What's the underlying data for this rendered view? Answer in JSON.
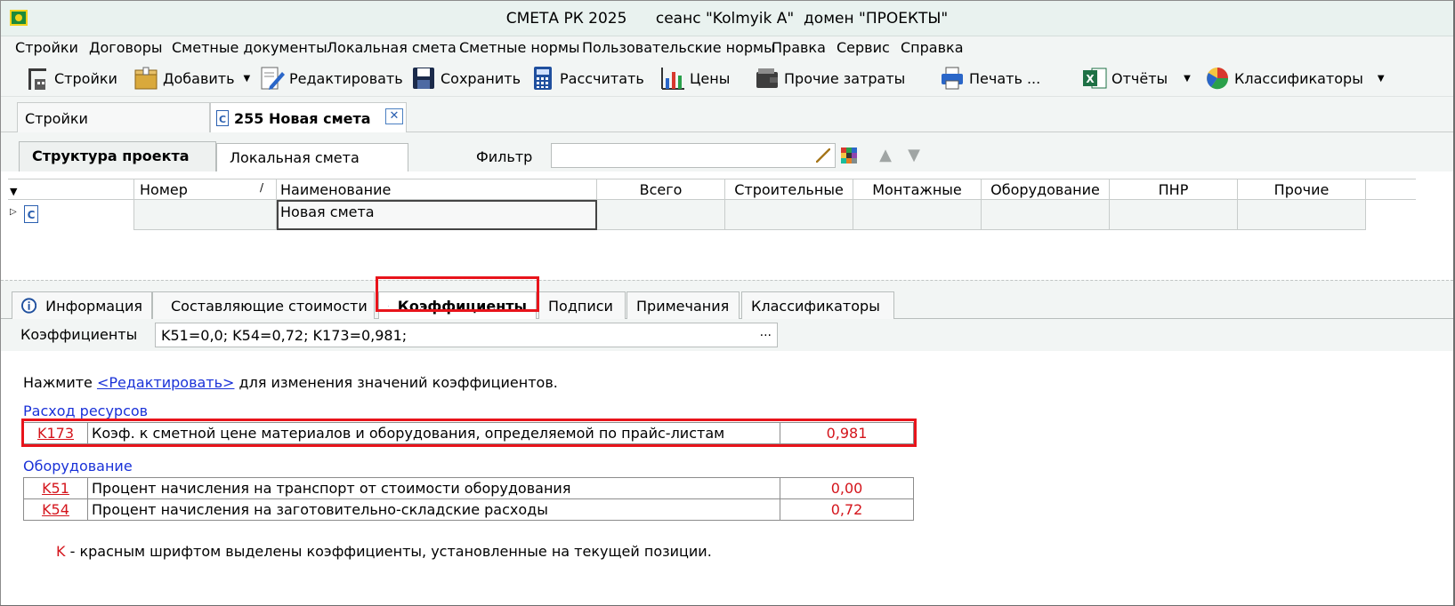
{
  "window": {
    "title": "СМЕТА РК 2025      сеанс \"Kolmyik A\"  домен \"ПРОЕКТЫ\""
  },
  "menu": [
    "Стройки",
    "Договоры",
    "Сметные документы",
    "Локальная смета",
    "Сметные нормы",
    "Пользовательские нормы",
    "Правка",
    "Сервис",
    "Справка"
  ],
  "toolbar": {
    "stroyki": "Стройки",
    "add": "Добавить",
    "edit": "Редактировать",
    "save": "Сохранить",
    "calc": "Рассчитать",
    "prices": "Цены",
    "other_costs": "Прочие затраты",
    "print": "Печать ...",
    "reports": "Отчёты",
    "classifiers": "Классификаторы"
  },
  "doc_tabs": {
    "stroyki": "Стройки",
    "smeta": "255 Новая смета",
    "close": "✕"
  },
  "project_tabs": {
    "structure": "Структура проекта",
    "local": "Локальная смета"
  },
  "filter": {
    "label": "Фильтр",
    "value": ""
  },
  "grid": {
    "columns": [
      "Номер",
      "Наименование",
      "Всего",
      "Строительные",
      "Монтажные",
      "Оборудование",
      "ПНР",
      "Прочие"
    ],
    "rows": [
      {
        "number": "",
        "name": "Новая смета",
        "total": "",
        "building": "",
        "mounting": "",
        "equipment": "",
        "pnr": "",
        "other": ""
      }
    ]
  },
  "info_tabs": {
    "info": "Информация",
    "components": "Составляющие стоимости",
    "coefficients": "Коэффициенты",
    "signatures": "Подписи",
    "notes": "Примечания",
    "classifiers": "Классификаторы"
  },
  "coefficients": {
    "label": "Коэффициенты",
    "value": "K51=0,0; K54=0,72; K173=0,981;",
    "dots": "...",
    "hint_prefix": "Нажмите ",
    "hint_link": "<Редактировать>",
    "hint_suffix": " для изменения значений коэффициентов.",
    "sections": [
      {
        "title": "Расход ресурсов",
        "items": [
          {
            "code": "K173",
            "name": "Коэф. к сметной цене материалов и оборудования, определяемой по прайс-листам",
            "value": "0,981"
          }
        ]
      },
      {
        "title": "Оборудование",
        "items": [
          {
            "code": "K51",
            "name": "Процент начисления на транспорт от стоимости оборудования",
            "value": "0,00"
          },
          {
            "code": "K54",
            "name": "Процент начисления на заготовительно-складские расходы",
            "value": "0,72"
          }
        ]
      }
    ],
    "legend_k": "K",
    "legend_text": " - красным шрифтом выделены коэффициенты, установленные на текущей позиции."
  },
  "colors": {
    "highlight": "#e8141b",
    "link": "#1a32d8",
    "red_value": "#d4141b"
  }
}
